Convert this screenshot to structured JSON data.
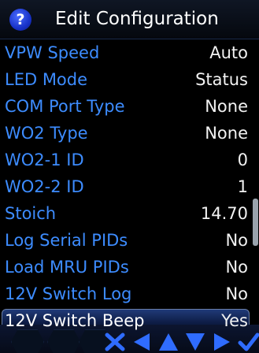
{
  "header": {
    "help_icon_glyph": "?",
    "title": "Edit Configuration"
  },
  "settings": [
    {
      "label": "VPW Speed",
      "value": "Auto"
    },
    {
      "label": "LED Mode",
      "value": "Status"
    },
    {
      "label": "COM Port Type",
      "value": "None"
    },
    {
      "label": "WO2 Type",
      "value": "None"
    },
    {
      "label": "WO2-1 ID",
      "value": "0"
    },
    {
      "label": "WO2-2 ID",
      "value": "1"
    },
    {
      "label": "Stoich",
      "value": "14.70"
    },
    {
      "label": "Log Serial PIDs",
      "value": "No"
    },
    {
      "label": "Load MRU PIDs",
      "value": "No"
    },
    {
      "label": "12V Switch Log",
      "value": "No"
    },
    {
      "label": "12V Switch Beep",
      "value": "Yes"
    }
  ],
  "selected_index": 10,
  "nav": {
    "buttons": [
      "cancel",
      "left",
      "up",
      "down",
      "right",
      "confirm"
    ]
  },
  "colors": {
    "label": "#3d8cff",
    "value": "#f2f2f2",
    "nav_icon": "#2f6cff",
    "background": "#000000"
  }
}
